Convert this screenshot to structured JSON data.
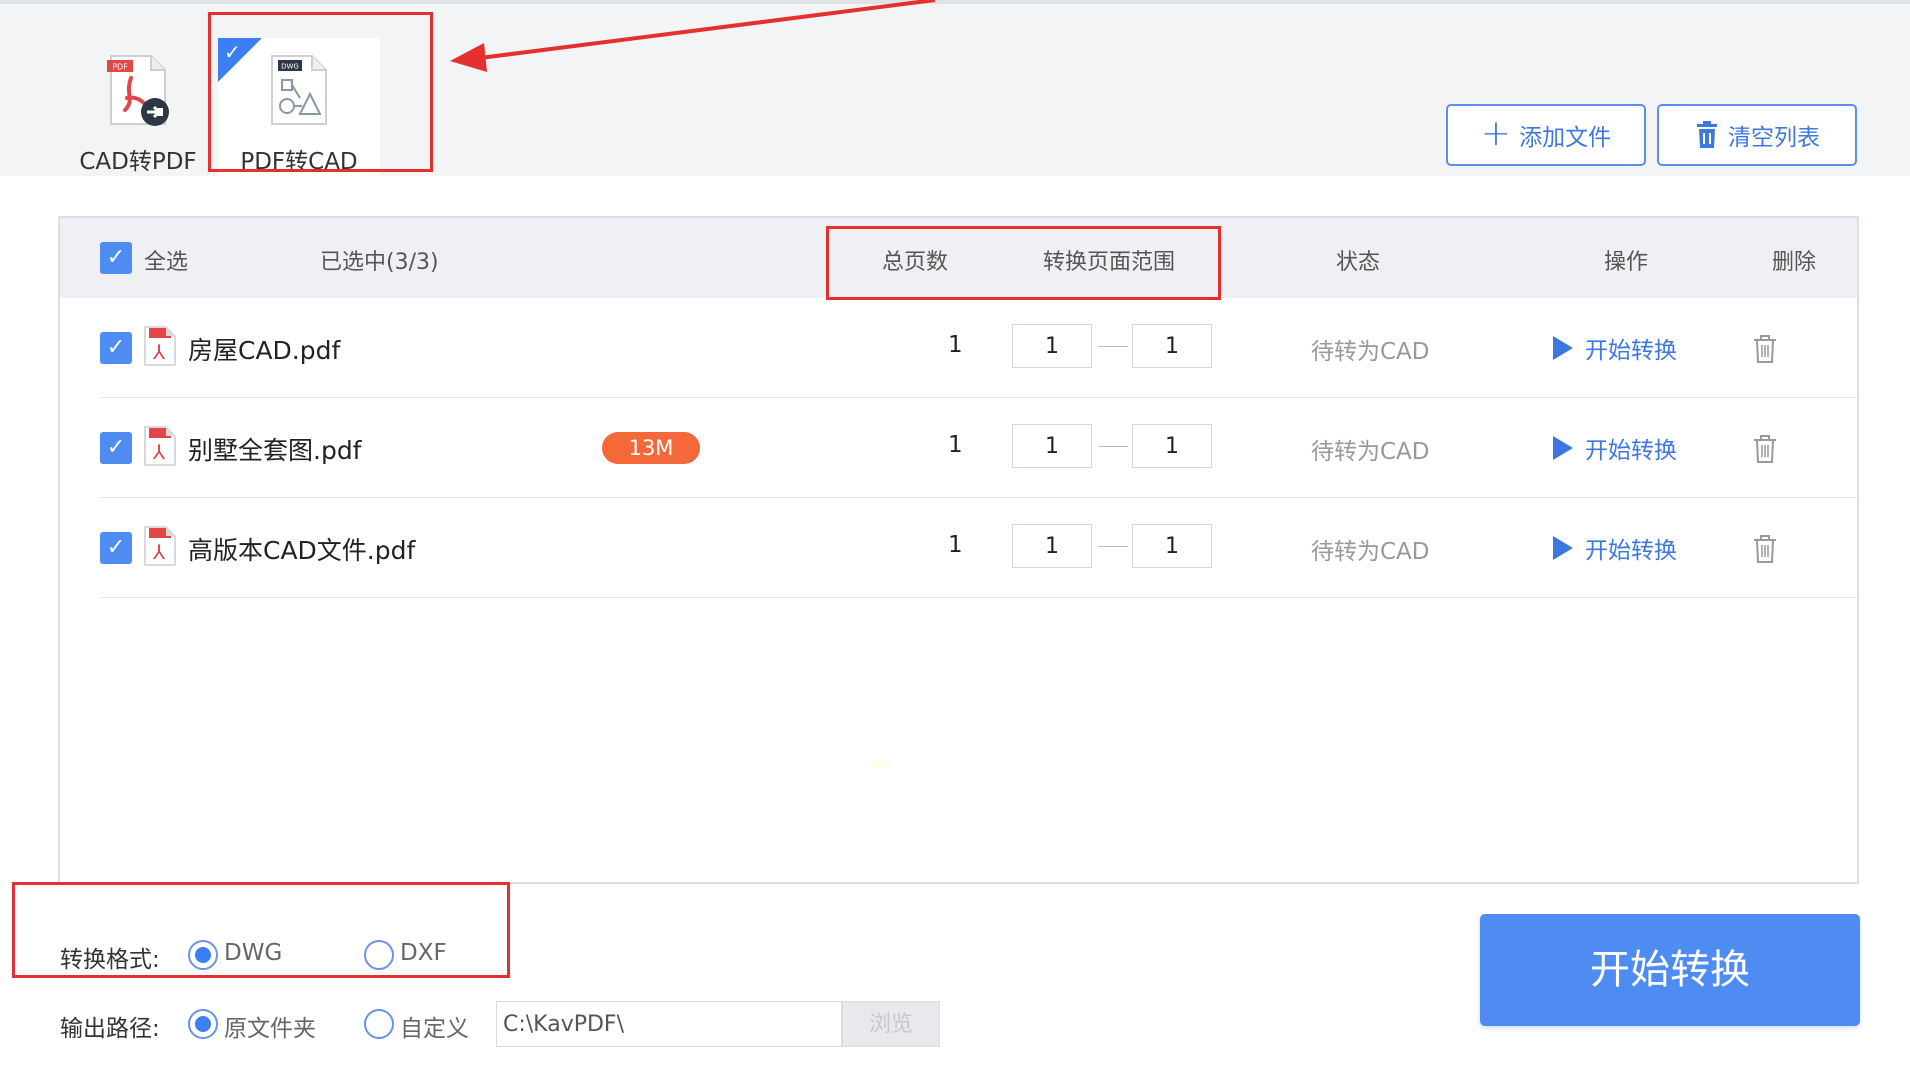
{
  "modes": [
    {
      "label": "CAD转PDF",
      "badge": "PDF"
    },
    {
      "label": "PDF转CAD",
      "badge": "DWG"
    }
  ],
  "toolbar": {
    "add_label": "添加文件",
    "clear_label": "清空列表"
  },
  "table": {
    "headers": {
      "select_all": "全选",
      "selected": "已选中(3/3)",
      "pages": "总页数",
      "range": "转换页面范围",
      "status": "状态",
      "action": "操作",
      "delete": "删除"
    },
    "rows": [
      {
        "name": "房屋CAD.pdf",
        "size": "",
        "pages": "1",
        "from": "1",
        "to": "1",
        "status": "待转为CAD",
        "action": "开始转换"
      },
      {
        "name": "别墅全套图.pdf",
        "size": "13M",
        "pages": "1",
        "from": "1",
        "to": "1",
        "status": "待转为CAD",
        "action": "开始转换"
      },
      {
        "name": "高版本CAD文件.pdf",
        "size": "",
        "pages": "1",
        "from": "1",
        "to": "1",
        "status": "待转为CAD",
        "action": "开始转换"
      }
    ]
  },
  "format": {
    "label": "转换格式:",
    "options": [
      "DWG",
      "DXF"
    ],
    "selected": "DWG"
  },
  "output": {
    "label": "输出路径:",
    "options": [
      "原文件夹",
      "自定义"
    ],
    "selected": "原文件夹",
    "path": "C:\\KavPDF\\",
    "browse": "浏览"
  },
  "start_button": "开始转换",
  "colors": {
    "accent": "#4e8cf1",
    "annotation": "#e53030",
    "size_badge": "#f5683a"
  }
}
